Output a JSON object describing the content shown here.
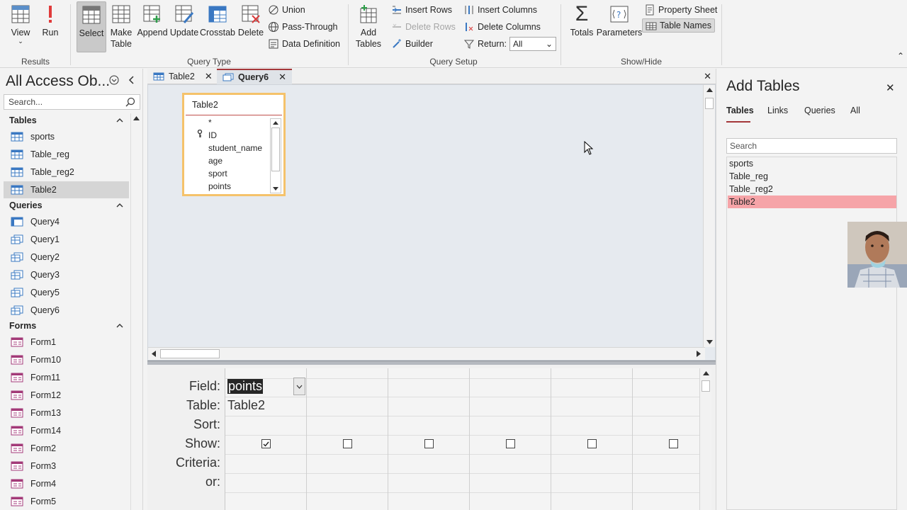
{
  "ribbon": {
    "results": {
      "view": "View",
      "run": "Run",
      "label": "Results"
    },
    "query_type": {
      "select": "Select",
      "make_table": [
        "Make",
        "Table"
      ],
      "append": "Append",
      "update": "Update",
      "crosstab": "Crosstab",
      "delete": "Delete",
      "union": "Union",
      "pass_through": "Pass-Through",
      "data_definition": "Data Definition",
      "label": "Query Type"
    },
    "query_setup": {
      "add_tables": [
        "Add",
        "Tables"
      ],
      "insert_rows": "Insert Rows",
      "delete_rows": "Delete Rows",
      "builder": "Builder",
      "insert_columns": "Insert Columns",
      "delete_columns": "Delete Columns",
      "return_label": "Return:",
      "return_value": "All",
      "label": "Query Setup"
    },
    "show_hide": {
      "totals": "Totals",
      "parameters": "Parameters",
      "property_sheet": "Property Sheet",
      "table_names": "Table Names",
      "label": "Show/Hide"
    }
  },
  "nav": {
    "title": "All Access Ob...",
    "search_placeholder": "Search...",
    "sections": [
      {
        "label": "Tables",
        "items": [
          "sports",
          "Table_reg",
          "Table_reg2",
          "Table2"
        ]
      },
      {
        "label": "Queries",
        "items": [
          "Query4",
          "Query1",
          "Query2",
          "Query3",
          "Query5",
          "Query6"
        ]
      },
      {
        "label": "Forms",
        "items": [
          "Form1",
          "Form10",
          "Form11",
          "Form12",
          "Form13",
          "Form14",
          "Form2",
          "Form3",
          "Form4",
          "Form5"
        ]
      }
    ],
    "selected_item": "Table2"
  },
  "doc": {
    "tabs": [
      {
        "label": "Table2",
        "active": false
      },
      {
        "label": "Query6",
        "active": true
      }
    ],
    "table_box": {
      "title": "Table2",
      "fields": [
        "*",
        "ID",
        "student_name",
        "age",
        "sport",
        "points"
      ]
    },
    "grid": {
      "row_labels": [
        "Field:",
        "Table:",
        "Sort:",
        "Show:",
        "Criteria:",
        "or:"
      ],
      "columns": [
        {
          "field": "points",
          "table": "Table2",
          "show": true
        },
        {
          "field": "",
          "table": "",
          "show": false
        },
        {
          "field": "",
          "table": "",
          "show": false
        },
        {
          "field": "",
          "table": "",
          "show": false
        },
        {
          "field": "",
          "table": "",
          "show": false
        },
        {
          "field": "",
          "table": "",
          "show": false
        }
      ]
    }
  },
  "add_tables": {
    "title": "Add Tables",
    "tabs": [
      "Tables",
      "Links",
      "Queries",
      "All"
    ],
    "active_tab": "Tables",
    "search_placeholder": "Search",
    "items": [
      "sports",
      "Table_reg",
      "Table_reg2",
      "Table2"
    ],
    "selected_item": "Table2"
  },
  "colors": {
    "accent": "#a4373a",
    "selection": "#f6a4a8",
    "table_box_border": "#f5c26b"
  }
}
